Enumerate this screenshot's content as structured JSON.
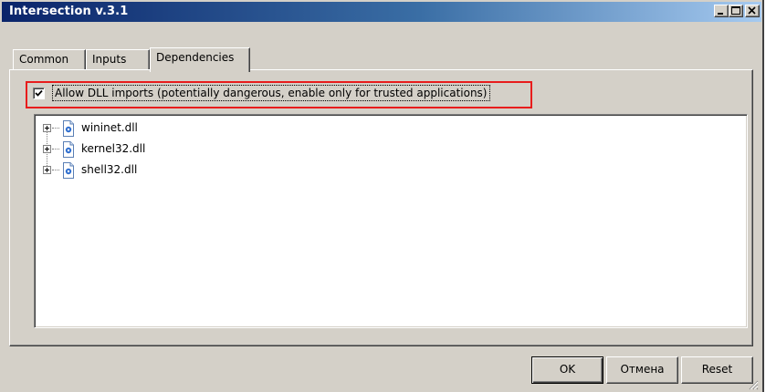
{
  "window": {
    "title": "Intersection v.3.1",
    "controls": [
      "minimize-icon",
      "maximize-icon",
      "close-icon"
    ]
  },
  "tabs": [
    {
      "label": "Common",
      "selected": false
    },
    {
      "label": "Inputs",
      "selected": false
    },
    {
      "label": "Dependencies",
      "selected": true
    }
  ],
  "dependencies": {
    "allow_dll": {
      "label": "Allow DLL imports (potentially dangerous, enable only for trusted applications)",
      "checked": true
    },
    "dlls": [
      {
        "label": "wininet.dll",
        "icon": "dll-file-icon",
        "expanded": false
      },
      {
        "label": "kernel32.dll",
        "icon": "dll-file-icon",
        "expanded": false
      },
      {
        "label": "shell32.dll",
        "icon": "dll-file-icon",
        "expanded": false
      }
    ]
  },
  "buttons": {
    "ok": "OK",
    "cancel": "Отмена",
    "reset": "Reset"
  },
  "colors": {
    "titlebar_start": "#0a246a",
    "titlebar_end": "#a6caf0",
    "face": "#d4d0c8",
    "highlight_border": "#e81c1c",
    "icon_blue": "#2f6fd0"
  }
}
